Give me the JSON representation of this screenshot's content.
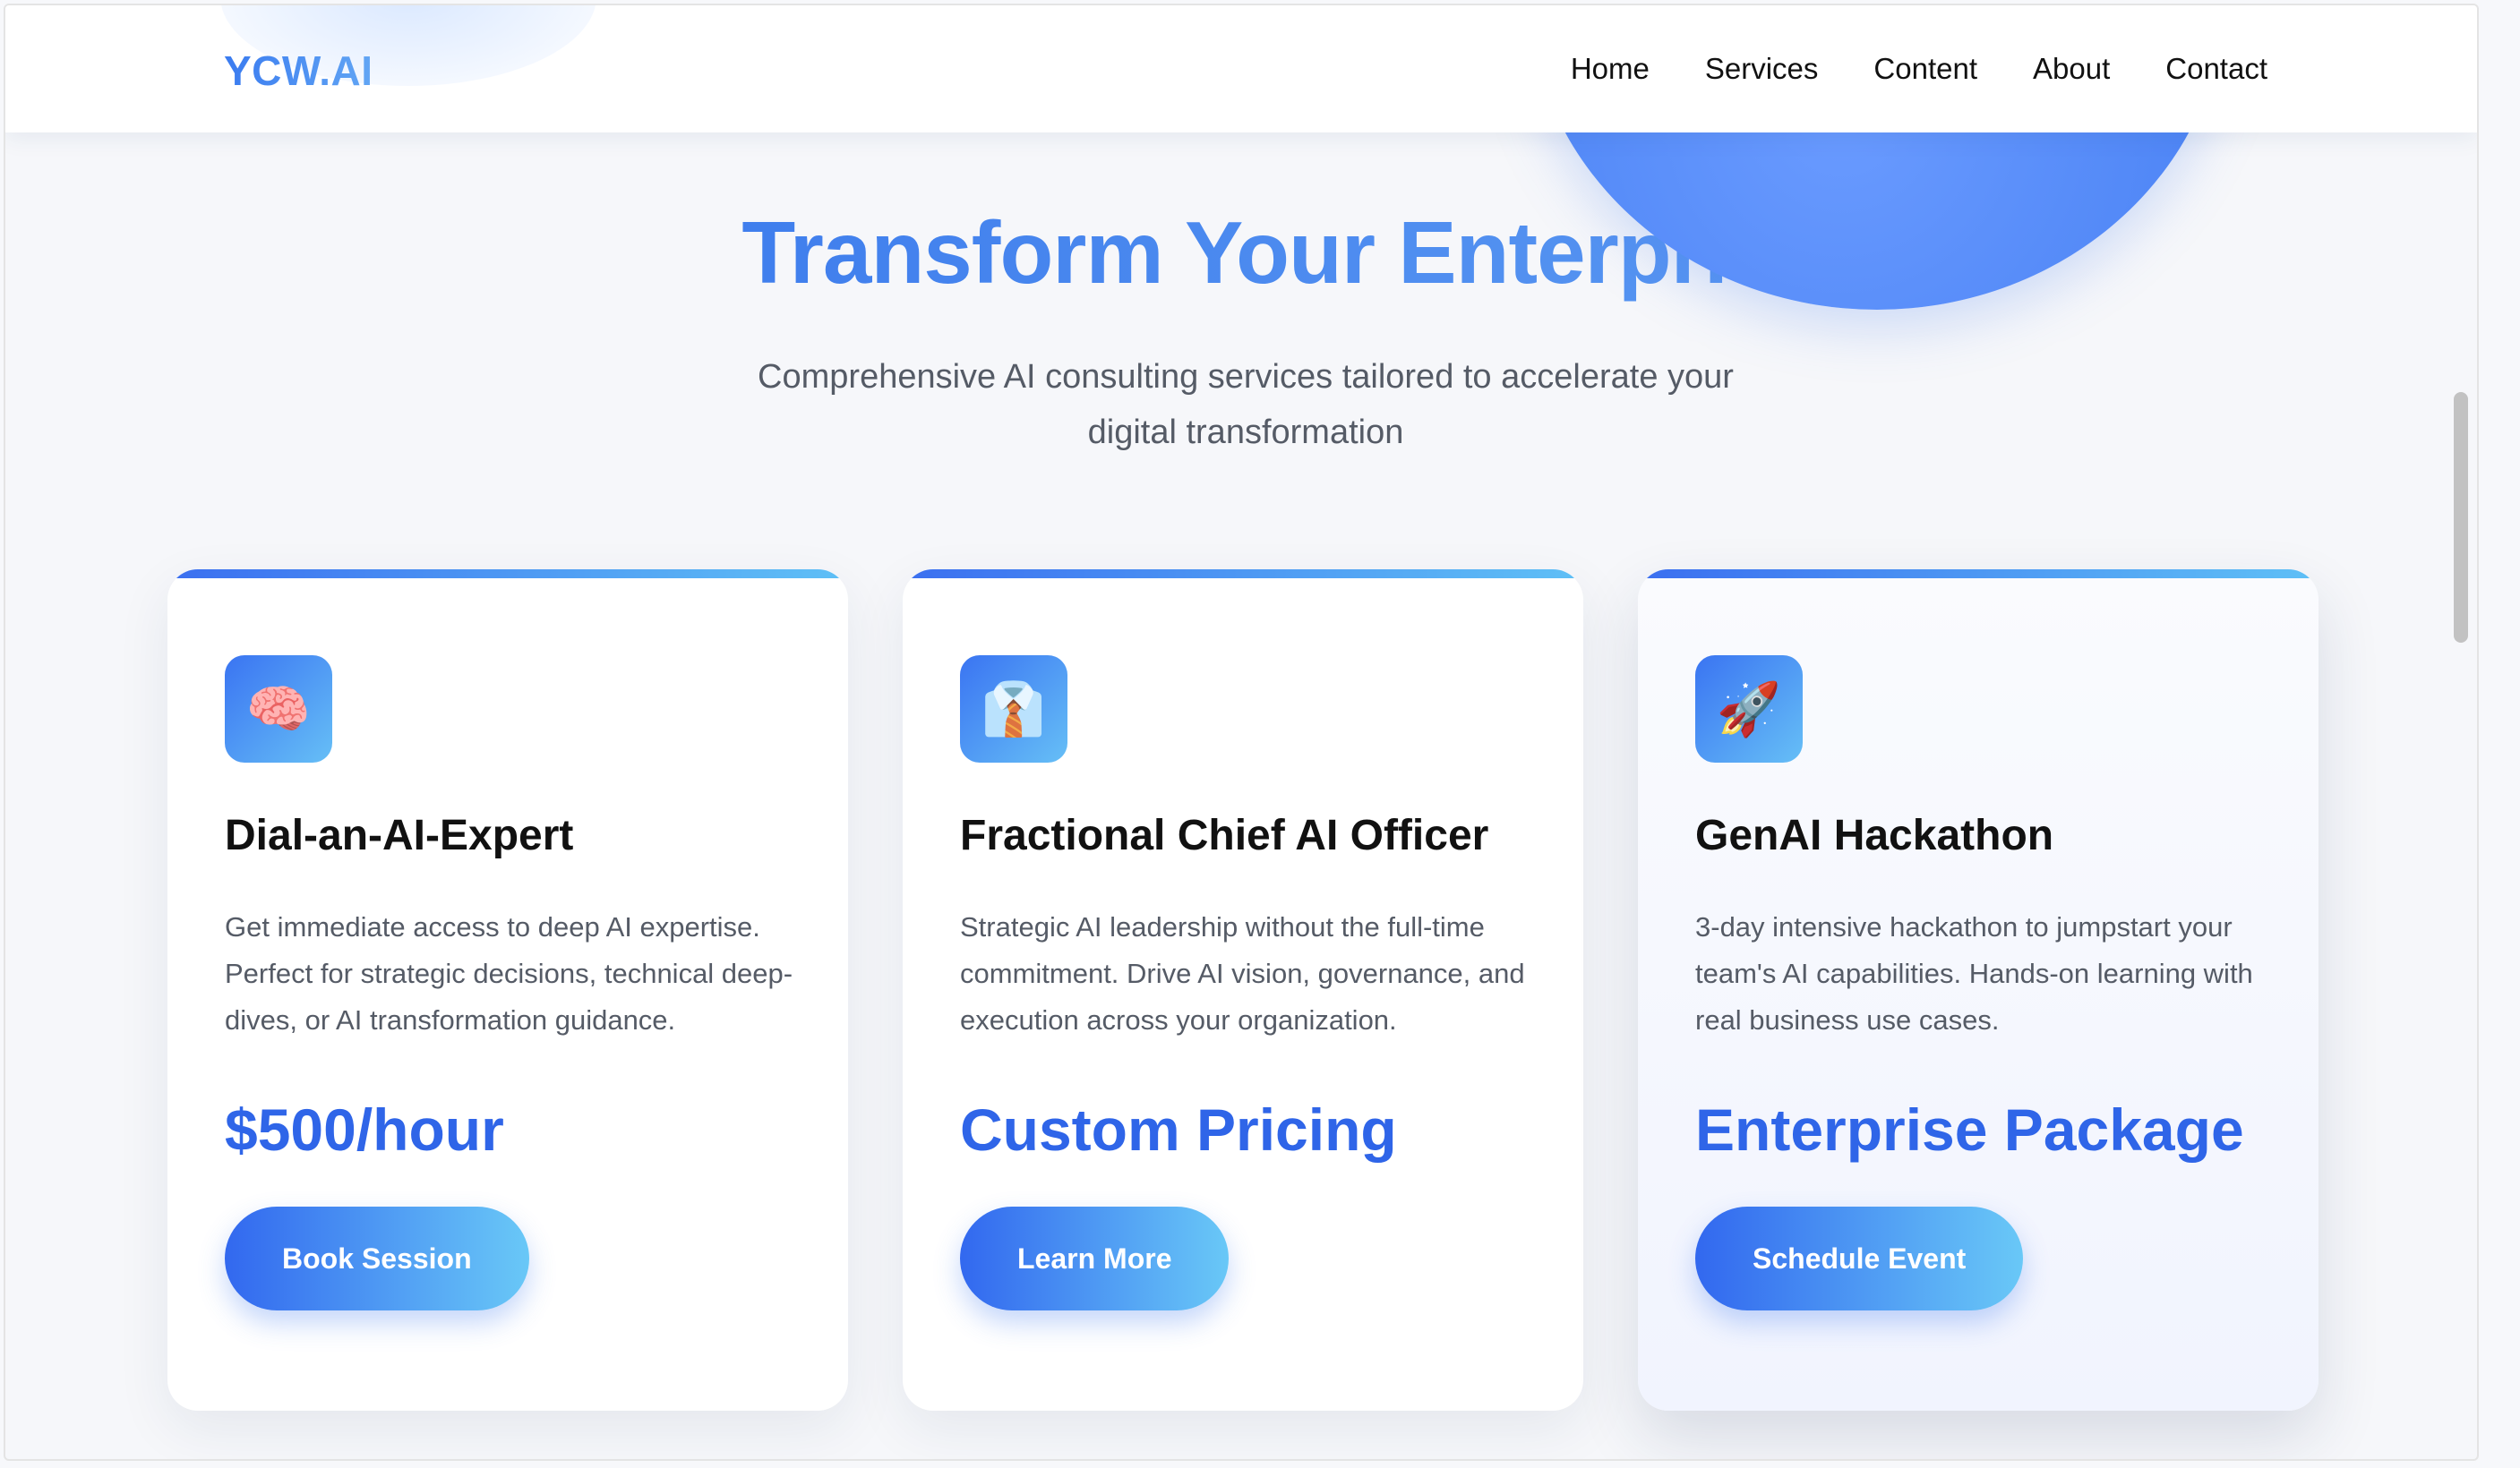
{
  "header": {
    "logo": "YCW.AI",
    "nav": [
      "Home",
      "Services",
      "Content",
      "About",
      "Contact"
    ]
  },
  "hero": {
    "title": "Transform Your Enterprise wi",
    "subtitle": "Comprehensive AI consulting services tailored to accelerate your digital transformation"
  },
  "cards": [
    {
      "icon": "brain-icon",
      "icon_glyph": "🧠",
      "title": "Dial-an-AI-Expert",
      "description": "Get immediate access to deep AI expertise. Perfect for strategic decisions, technical deep-dives, or AI transformation guidance.",
      "price": "$500/hour",
      "button": "Book Session"
    },
    {
      "icon": "executive-icon",
      "icon_glyph": "👔",
      "title": "Fractional Chief AI Officer",
      "description": "Strategic AI leadership without the full-time commitment. Drive AI vision, governance, and execution across your organization.",
      "price": "Custom Pricing",
      "button": "Learn More"
    },
    {
      "icon": "rocket-icon",
      "icon_glyph": "🚀",
      "title": "GenAI Hackathon",
      "description": "3-day intensive hackathon to jumpstart your team's AI capabilities. Hands-on learning with real business use cases.",
      "price": "Enterprise Package",
      "button": "Schedule Event"
    }
  ],
  "colors": {
    "accent": "#2f65e8",
    "gradient_start": "#3268ef",
    "gradient_end": "#69c8f7"
  }
}
